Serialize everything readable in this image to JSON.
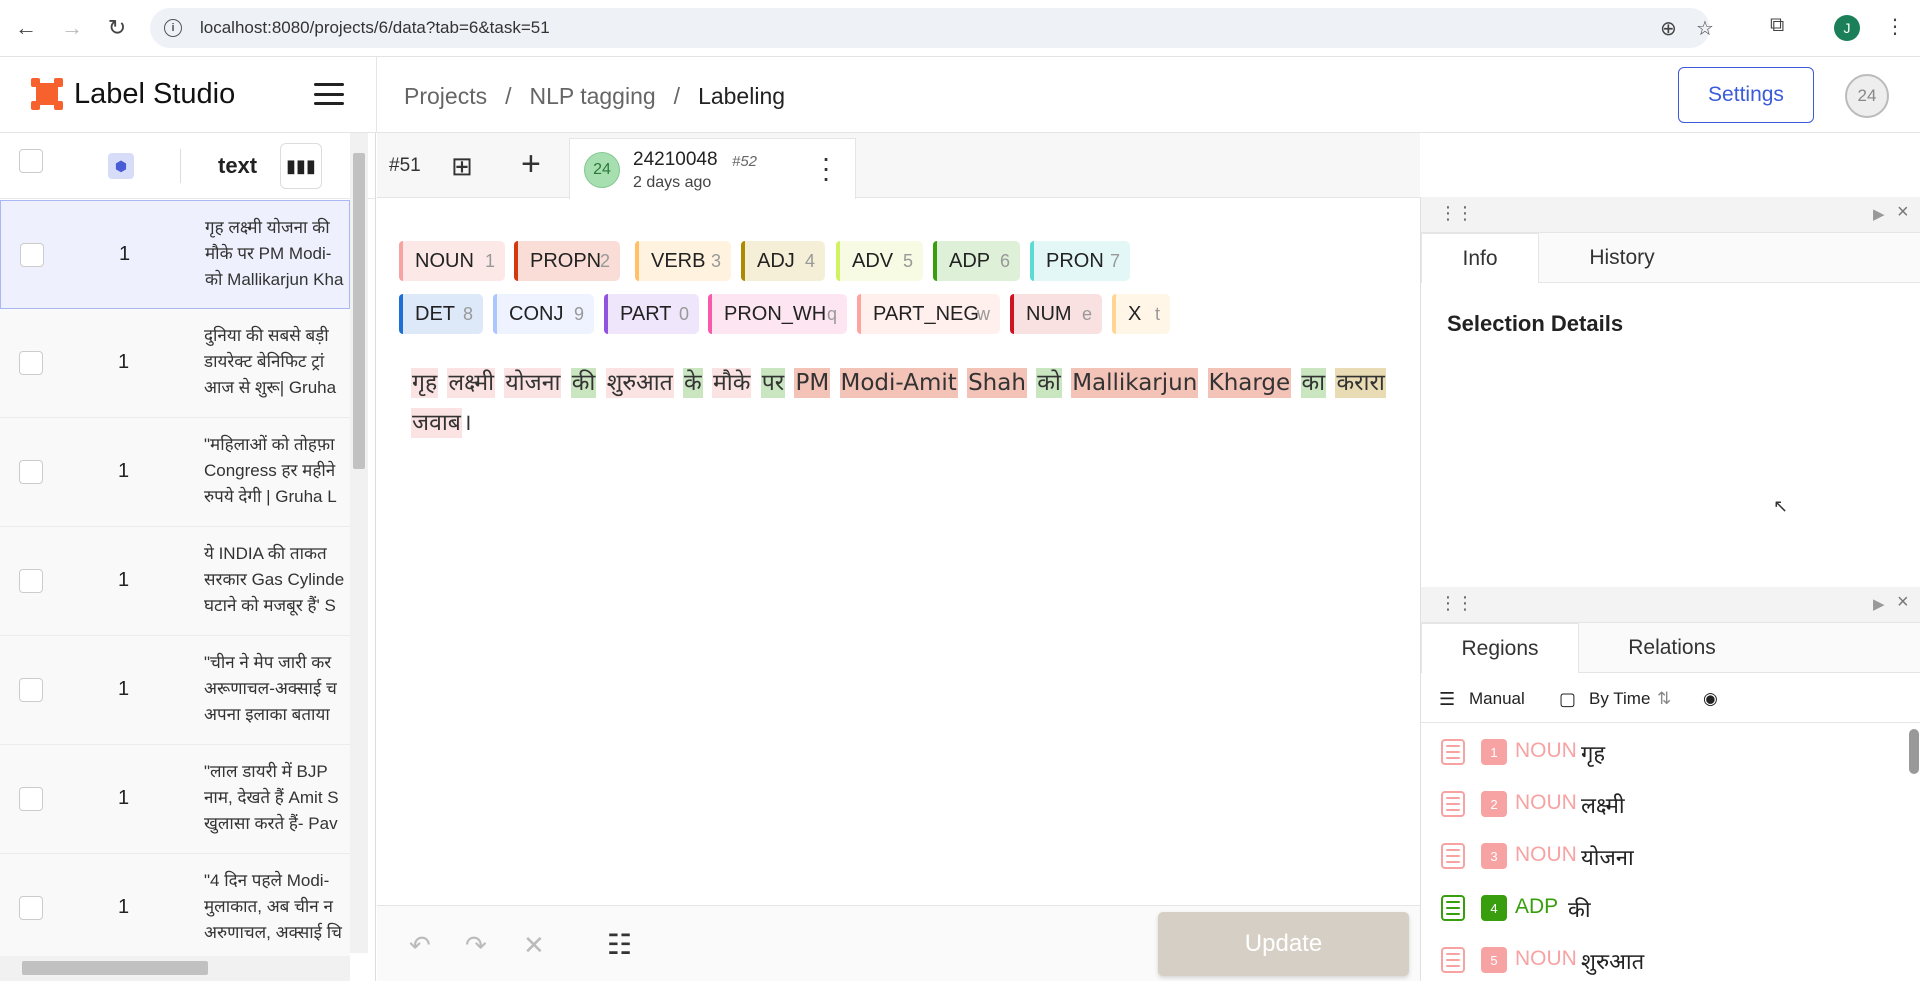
{
  "browser": {
    "url": "localhost:8080/projects/6/data?tab=6&task=51",
    "profile_initial": "J"
  },
  "app": {
    "name": "Label Studio",
    "breadcrumb": [
      "Projects",
      "/",
      "NLP tagging",
      "/",
      "Labeling"
    ],
    "settings_label": "Settings",
    "user_badge": "24"
  },
  "list": {
    "column_label": "text",
    "rows": [
      {
        "count": "1",
        "lines": [
          "गृह लक्ष्मी योजना की",
          "मौके पर PM Modi-",
          "को Mallikarjun Kha"
        ]
      },
      {
        "count": "1",
        "lines": [
          "दुनिया की सबसे बड़ी",
          "डायरेक्ट बेनिफिट ट्रां",
          "आज से शुरू| Gruha"
        ]
      },
      {
        "count": "1",
        "lines": [
          "\"महिलाओं को तोहफ़ा",
          "Congress हर महीने",
          "रुपये देगी | Gruha L"
        ]
      },
      {
        "count": "1",
        "lines": [
          "ये INDIA की ताकत",
          "सरकार Gas Cylinde",
          "घटाने को मजबूर हैं' S"
        ]
      },
      {
        "count": "1",
        "lines": [
          "\"चीन ने मेप जारी कर",
          "अरूणाचल-अक्साई च",
          "अपना इलाका बताया"
        ]
      },
      {
        "count": "1",
        "lines": [
          "\"लाल डायरी में BJP",
          "नाम, देखते हैं Amit S",
          "खुलासा करते हैं- Pav"
        ]
      },
      {
        "count": "1",
        "lines": [
          "\"4 दिन पहले Modi-",
          "मुलाकात, अब चीन न",
          "अरुणाचल, अक्साई चि"
        ]
      }
    ]
  },
  "task": {
    "id": "#51",
    "annotation_id": "24210048",
    "annotation_sub": "#52",
    "annotator_initials": "24",
    "time": "2 days ago"
  },
  "labels": [
    {
      "name": "NOUN",
      "key": "1",
      "color": "#f7a3a3",
      "bg": "#fde8e8"
    },
    {
      "name": "PROPN",
      "key": "2",
      "color": "#d4380d",
      "bg": "#f9ddd6"
    },
    {
      "name": "VERB",
      "key": "3",
      "color": "#ffc069",
      "bg": "#fff3e0"
    },
    {
      "name": "ADJ",
      "key": "4",
      "color": "#ad8b00",
      "bg": "#f6efd8"
    },
    {
      "name": "ADV",
      "key": "5",
      "color": "#d3f261",
      "bg": "#f7fbe3"
    },
    {
      "name": "ADP",
      "key": "6",
      "color": "#389e0d",
      "bg": "#dff0d8"
    },
    {
      "name": "PRON",
      "key": "7",
      "color": "#5cdbd3",
      "bg": "#e3f8f6"
    },
    {
      "name": "DET",
      "key": "8",
      "color": "#1d6fd6",
      "bg": "#dde8f8"
    },
    {
      "name": "CONJ",
      "key": "9",
      "color": "#adc6ff",
      "bg": "#eef3ff"
    },
    {
      "name": "PART",
      "key": "0",
      "color": "#9254de",
      "bg": "#efe6fb"
    },
    {
      "name": "PRON_WH",
      "key": "q",
      "color": "#f759ab",
      "bg": "#fde6f1"
    },
    {
      "name": "PART_NEG",
      "key": "w",
      "color": "#ffa39e",
      "bg": "#fff0ee"
    },
    {
      "name": "NUM",
      "key": "e",
      "color": "#cf1322",
      "bg": "#f9e1e1"
    },
    {
      "name": "X",
      "key": "t",
      "color": "#ffd591",
      "bg": "#fff6e8"
    }
  ],
  "text_tokens": [
    {
      "t": "गृह",
      "bg": "#fbe3e3"
    },
    {
      "t": " ",
      "bg": ""
    },
    {
      "t": "लक्ष्मी",
      "bg": "#fbe3e3"
    },
    {
      "t": " ",
      "bg": ""
    },
    {
      "t": "योजना",
      "bg": "#fbe3e3"
    },
    {
      "t": " ",
      "bg": ""
    },
    {
      "t": "की",
      "bg": "#c9e6c0"
    },
    {
      "t": " ",
      "bg": ""
    },
    {
      "t": "शुरुआत",
      "bg": "#fbe3e3"
    },
    {
      "t": " ",
      "bg": ""
    },
    {
      "t": "के",
      "bg": "#c9e6c0"
    },
    {
      "t": " ",
      "bg": ""
    },
    {
      "t": "मौके",
      "bg": "#fbe3e3"
    },
    {
      "t": " ",
      "bg": ""
    },
    {
      "t": "पर",
      "bg": "#c9e6c0"
    },
    {
      "t": " ",
      "bg": ""
    },
    {
      "t": "PM",
      "bg": "#f3c3b8"
    },
    {
      "t": " ",
      "bg": ""
    },
    {
      "t": "Modi-Amit",
      "bg": "#f3c3b8"
    },
    {
      "t": " ",
      "bg": ""
    },
    {
      "t": "Shah",
      "bg": "#f3c3b8"
    },
    {
      "t": " ",
      "bg": ""
    },
    {
      "t": "को",
      "bg": "#c9e6c0"
    },
    {
      "t": " ",
      "bg": ""
    },
    {
      "t": "Mallikarjun",
      "bg": "#f3c3b8"
    },
    {
      "t": " ",
      "bg": ""
    },
    {
      "t": "Kharge",
      "bg": "#f3c3b8"
    },
    {
      "t": " ",
      "bg": ""
    },
    {
      "t": "का",
      "bg": "#c9e6c0"
    },
    {
      "t": " ",
      "bg": ""
    },
    {
      "t": "करारा",
      "bg": "#e9dcb4"
    },
    {
      "t": " ",
      "bg": ""
    },
    {
      "t": "जवाब",
      "bg": "#fbe3e3"
    },
    {
      "t": "।",
      "bg": ""
    }
  ],
  "footer": {
    "update_label": "Update"
  },
  "panel_top": {
    "tabs": [
      "Info",
      "History"
    ],
    "selection_title": "Selection Details"
  },
  "panel_bottom": {
    "tabs": [
      "Regions",
      "Relations"
    ],
    "toolbar": {
      "manual": "Manual",
      "sort": "By Time"
    },
    "regions": [
      {
        "n": "1",
        "label": "NOUN",
        "text": "गृह",
        "color": "#f7a3a3"
      },
      {
        "n": "2",
        "label": "NOUN",
        "text": "लक्ष्मी",
        "color": "#f7a3a3"
      },
      {
        "n": "3",
        "label": "NOUN",
        "text": "योजना",
        "color": "#f7a3a3"
      },
      {
        "n": "4",
        "label": "ADP",
        "text": "की",
        "color": "#389e0d"
      },
      {
        "n": "5",
        "label": "NOUN",
        "text": "शुरुआत",
        "color": "#f7a3a3"
      }
    ]
  }
}
